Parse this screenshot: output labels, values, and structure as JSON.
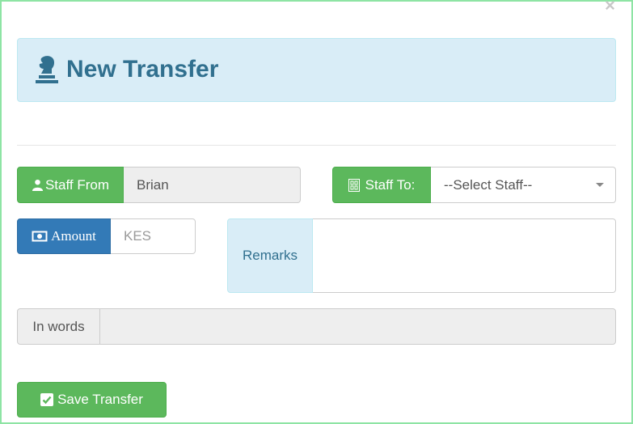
{
  "modal": {
    "close_label": "×",
    "title": "New Transfer",
    "title_icon": "knight-icon"
  },
  "form": {
    "staff_from": {
      "label": "Staff From",
      "icon": "user-icon",
      "value": "Brian"
    },
    "staff_to": {
      "label": "Staff To:",
      "icon": "list-icon",
      "selected": "--Select Staff--"
    },
    "amount": {
      "label": "Amount",
      "icon": "money-icon",
      "placeholder": "KES",
      "value": ""
    },
    "remarks": {
      "label": "Remarks",
      "value": ""
    },
    "in_words": {
      "label": "In words",
      "value": ""
    }
  },
  "actions": {
    "save_label": "Save Transfer",
    "save_icon": "check-square-icon"
  },
  "colors": {
    "success": "#5cb85c",
    "primary": "#337ab7",
    "info_bg": "#d9edf7",
    "info_text": "#31708f",
    "modal_border": "#8ee4a4"
  }
}
